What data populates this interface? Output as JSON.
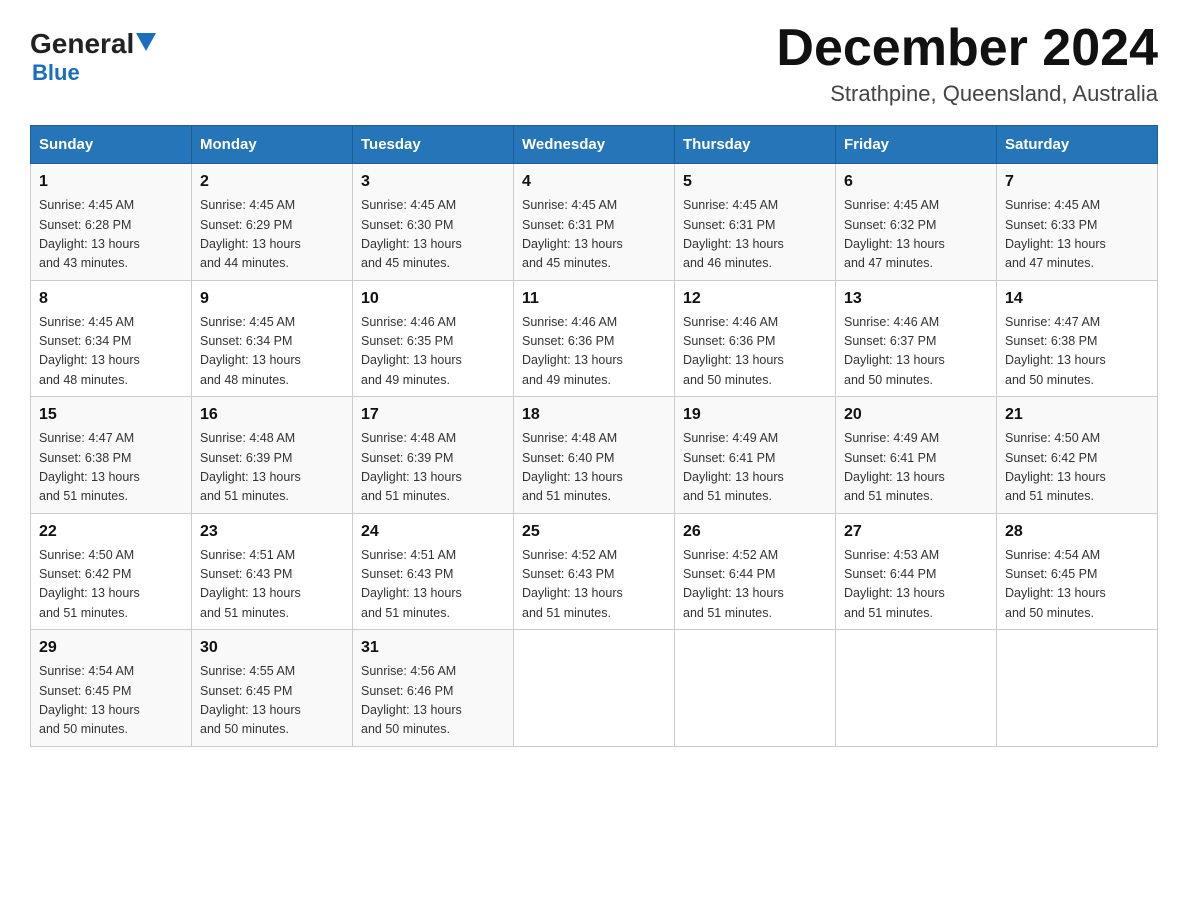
{
  "header": {
    "logo_general": "General",
    "logo_blue": "Blue",
    "month_title": "December 2024",
    "location": "Strathpine, Queensland, Australia"
  },
  "days_of_week": [
    "Sunday",
    "Monday",
    "Tuesday",
    "Wednesday",
    "Thursday",
    "Friday",
    "Saturday"
  ],
  "weeks": [
    [
      {
        "day": "1",
        "sunrise": "4:45 AM",
        "sunset": "6:28 PM",
        "daylight": "13 hours and 43 minutes."
      },
      {
        "day": "2",
        "sunrise": "4:45 AM",
        "sunset": "6:29 PM",
        "daylight": "13 hours and 44 minutes."
      },
      {
        "day": "3",
        "sunrise": "4:45 AM",
        "sunset": "6:30 PM",
        "daylight": "13 hours and 45 minutes."
      },
      {
        "day": "4",
        "sunrise": "4:45 AM",
        "sunset": "6:31 PM",
        "daylight": "13 hours and 45 minutes."
      },
      {
        "day": "5",
        "sunrise": "4:45 AM",
        "sunset": "6:31 PM",
        "daylight": "13 hours and 46 minutes."
      },
      {
        "day": "6",
        "sunrise": "4:45 AM",
        "sunset": "6:32 PM",
        "daylight": "13 hours and 47 minutes."
      },
      {
        "day": "7",
        "sunrise": "4:45 AM",
        "sunset": "6:33 PM",
        "daylight": "13 hours and 47 minutes."
      }
    ],
    [
      {
        "day": "8",
        "sunrise": "4:45 AM",
        "sunset": "6:34 PM",
        "daylight": "13 hours and 48 minutes."
      },
      {
        "day": "9",
        "sunrise": "4:45 AM",
        "sunset": "6:34 PM",
        "daylight": "13 hours and 48 minutes."
      },
      {
        "day": "10",
        "sunrise": "4:46 AM",
        "sunset": "6:35 PM",
        "daylight": "13 hours and 49 minutes."
      },
      {
        "day": "11",
        "sunrise": "4:46 AM",
        "sunset": "6:36 PM",
        "daylight": "13 hours and 49 minutes."
      },
      {
        "day": "12",
        "sunrise": "4:46 AM",
        "sunset": "6:36 PM",
        "daylight": "13 hours and 50 minutes."
      },
      {
        "day": "13",
        "sunrise": "4:46 AM",
        "sunset": "6:37 PM",
        "daylight": "13 hours and 50 minutes."
      },
      {
        "day": "14",
        "sunrise": "4:47 AM",
        "sunset": "6:38 PM",
        "daylight": "13 hours and 50 minutes."
      }
    ],
    [
      {
        "day": "15",
        "sunrise": "4:47 AM",
        "sunset": "6:38 PM",
        "daylight": "13 hours and 51 minutes."
      },
      {
        "day": "16",
        "sunrise": "4:48 AM",
        "sunset": "6:39 PM",
        "daylight": "13 hours and 51 minutes."
      },
      {
        "day": "17",
        "sunrise": "4:48 AM",
        "sunset": "6:39 PM",
        "daylight": "13 hours and 51 minutes."
      },
      {
        "day": "18",
        "sunrise": "4:48 AM",
        "sunset": "6:40 PM",
        "daylight": "13 hours and 51 minutes."
      },
      {
        "day": "19",
        "sunrise": "4:49 AM",
        "sunset": "6:41 PM",
        "daylight": "13 hours and 51 minutes."
      },
      {
        "day": "20",
        "sunrise": "4:49 AM",
        "sunset": "6:41 PM",
        "daylight": "13 hours and 51 minutes."
      },
      {
        "day": "21",
        "sunrise": "4:50 AM",
        "sunset": "6:42 PM",
        "daylight": "13 hours and 51 minutes."
      }
    ],
    [
      {
        "day": "22",
        "sunrise": "4:50 AM",
        "sunset": "6:42 PM",
        "daylight": "13 hours and 51 minutes."
      },
      {
        "day": "23",
        "sunrise": "4:51 AM",
        "sunset": "6:43 PM",
        "daylight": "13 hours and 51 minutes."
      },
      {
        "day": "24",
        "sunrise": "4:51 AM",
        "sunset": "6:43 PM",
        "daylight": "13 hours and 51 minutes."
      },
      {
        "day": "25",
        "sunrise": "4:52 AM",
        "sunset": "6:43 PM",
        "daylight": "13 hours and 51 minutes."
      },
      {
        "day": "26",
        "sunrise": "4:52 AM",
        "sunset": "6:44 PM",
        "daylight": "13 hours and 51 minutes."
      },
      {
        "day": "27",
        "sunrise": "4:53 AM",
        "sunset": "6:44 PM",
        "daylight": "13 hours and 51 minutes."
      },
      {
        "day": "28",
        "sunrise": "4:54 AM",
        "sunset": "6:45 PM",
        "daylight": "13 hours and 50 minutes."
      }
    ],
    [
      {
        "day": "29",
        "sunrise": "4:54 AM",
        "sunset": "6:45 PM",
        "daylight": "13 hours and 50 minutes."
      },
      {
        "day": "30",
        "sunrise": "4:55 AM",
        "sunset": "6:45 PM",
        "daylight": "13 hours and 50 minutes."
      },
      {
        "day": "31",
        "sunrise": "4:56 AM",
        "sunset": "6:46 PM",
        "daylight": "13 hours and 50 minutes."
      },
      null,
      null,
      null,
      null
    ]
  ],
  "labels": {
    "sunrise": "Sunrise:",
    "sunset": "Sunset:",
    "daylight": "Daylight:"
  }
}
